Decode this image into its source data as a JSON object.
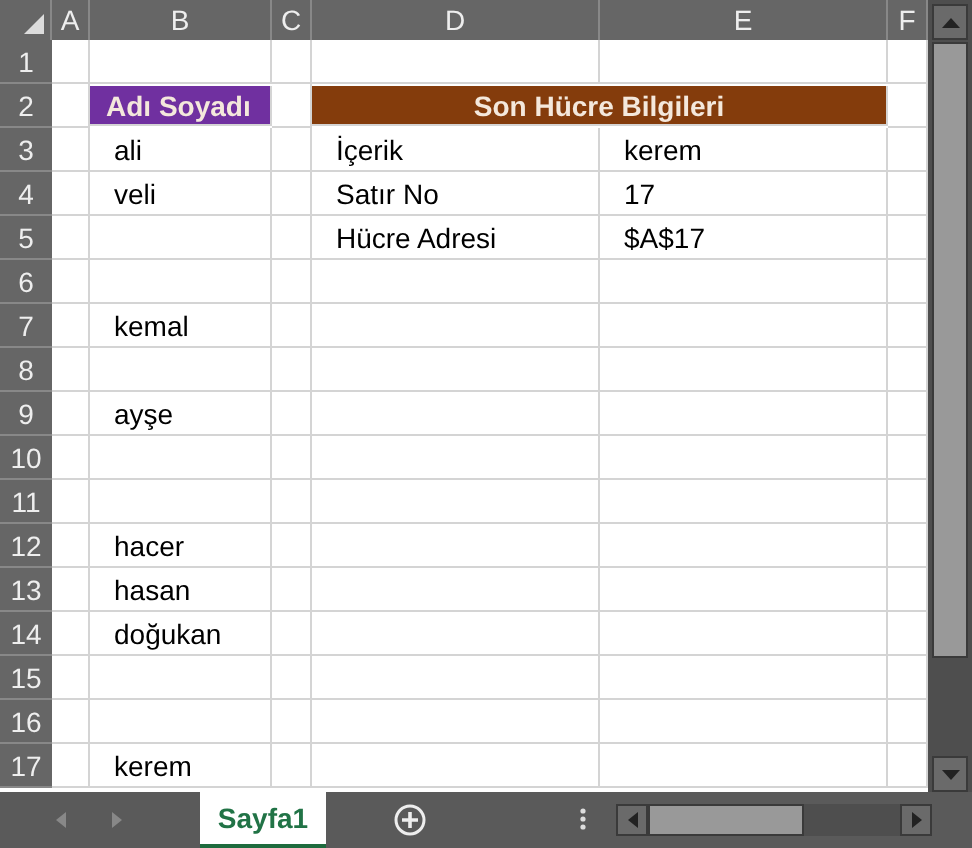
{
  "columns": [
    "A",
    "B",
    "C",
    "D",
    "E",
    "F"
  ],
  "rows": [
    {
      "number": "1",
      "cells": {}
    },
    {
      "number": "2",
      "cells": {
        "B": {
          "text": "Adı Soyadı",
          "color": "#7030a0",
          "merged": false
        },
        "D": {
          "text": "Son Hücre Bilgileri",
          "color": "#843c0c",
          "merged": true
        }
      }
    },
    {
      "number": "3",
      "cells": {
        "B": "ali",
        "D": "İçerik",
        "E": "kerem"
      }
    },
    {
      "number": "4",
      "cells": {
        "B": "veli",
        "D": "Satır No",
        "E": "17"
      }
    },
    {
      "number": "5",
      "cells": {
        "D": "Hücre Adresi",
        "E": "$A$17"
      }
    },
    {
      "number": "6",
      "cells": {}
    },
    {
      "number": "7",
      "cells": {
        "B": "kemal"
      }
    },
    {
      "number": "8",
      "cells": {}
    },
    {
      "number": "9",
      "cells": {
        "B": "ayşe"
      }
    },
    {
      "number": "10",
      "cells": {}
    },
    {
      "number": "11",
      "cells": {}
    },
    {
      "number": "12",
      "cells": {
        "B": "hacer"
      }
    },
    {
      "number": "13",
      "cells": {
        "B": "hasan"
      }
    },
    {
      "number": "14",
      "cells": {
        "B": "doğukan"
      }
    },
    {
      "number": "15",
      "cells": {}
    },
    {
      "number": "16",
      "cells": {}
    },
    {
      "number": "17",
      "cells": {
        "B": "kerem"
      }
    }
  ],
  "sheet_tabs": [
    {
      "label": "Sayfa1",
      "selected": true
    }
  ]
}
